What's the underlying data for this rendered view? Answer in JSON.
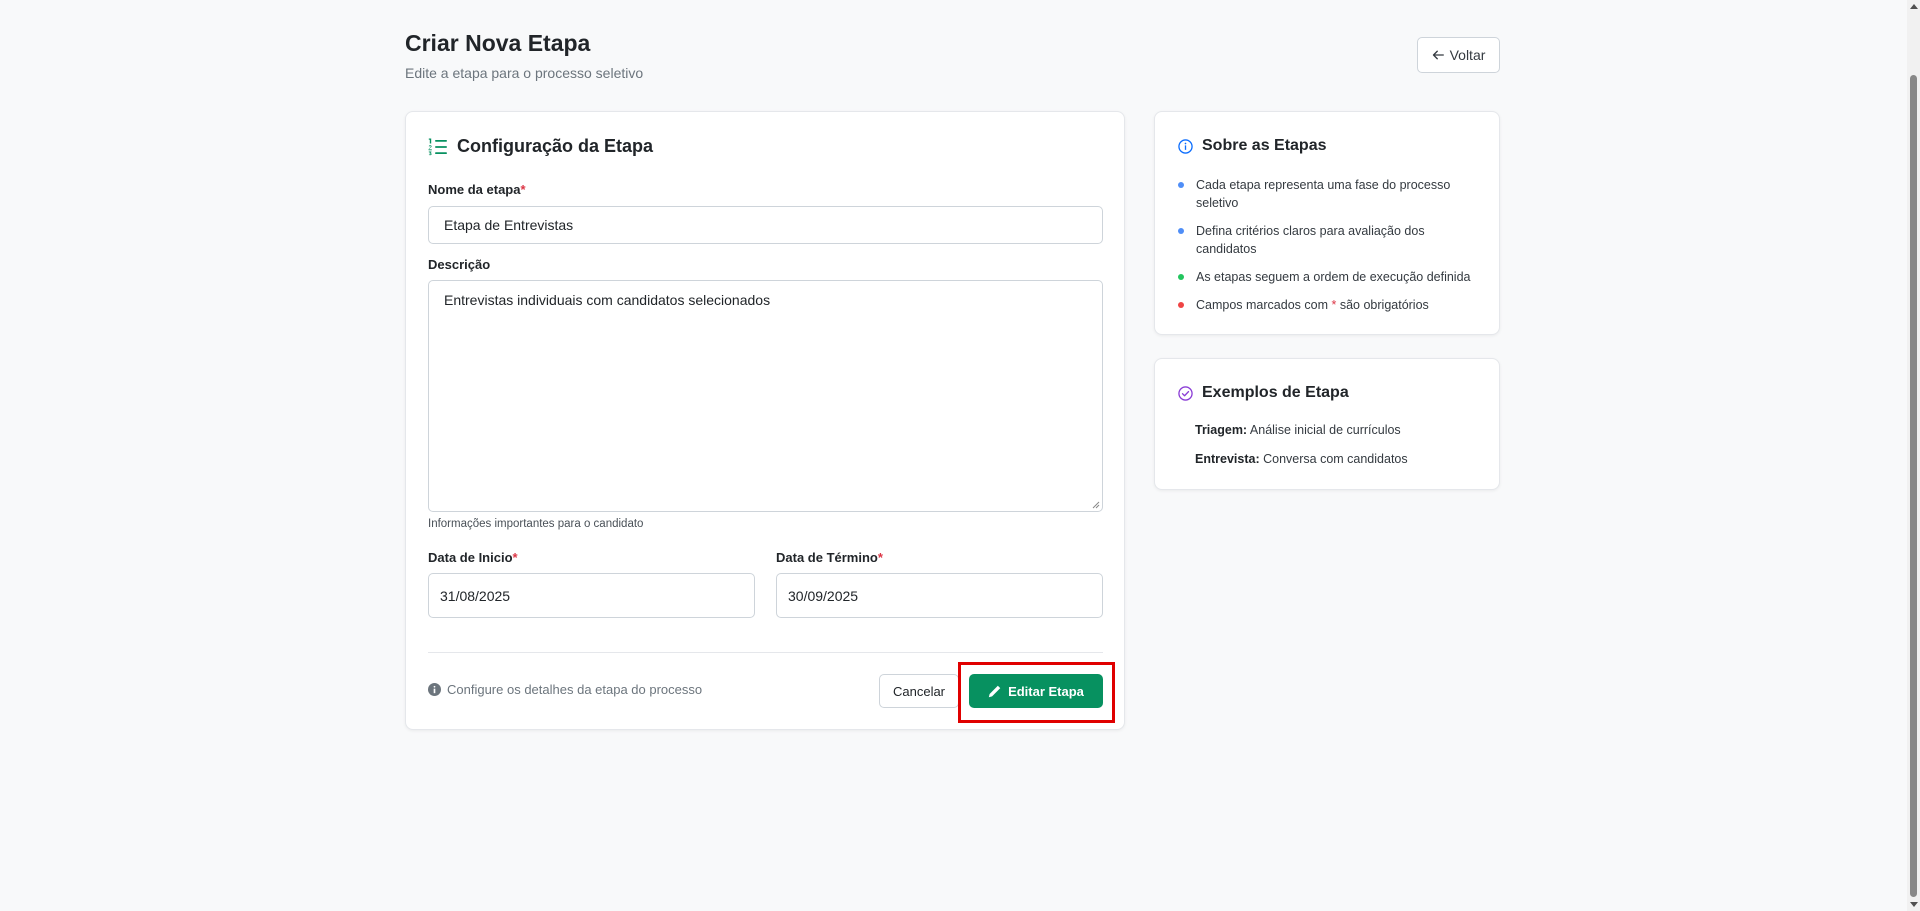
{
  "header": {
    "title": "Criar Nova Etapa",
    "subtitle": "Edite a etapa para o processo seletivo",
    "back_label": "Voltar"
  },
  "form": {
    "title": "Configuração da Etapa",
    "name_label": "Nome da etapa",
    "name_value": "Etapa de Entrevistas",
    "description_label": "Descrição",
    "description_value": "Entrevistas individuais com candidatos selecionados",
    "description_help": "Informações importantes para o candidato",
    "start_label": "Data de Inicio",
    "start_value": "31/08/2025",
    "end_label": "Data de Término",
    "end_value": "30/09/2025",
    "required_mark": "*",
    "footer_note": "Configure os detalhes da etapa do processo",
    "cancel_label": "Cancelar",
    "submit_label": "Editar Etapa"
  },
  "about": {
    "title": "Sobre as Etapas",
    "tips": [
      "Cada etapa representa uma fase do processo seletivo",
      "Defina critérios claros para avaliação dos candidatos",
      "As etapas seguem a ordem de execução definida"
    ],
    "required_tip_prefix": "Campos marcados com",
    "required_tip_mark": "*",
    "required_tip_suffix": "são obrigatórios"
  },
  "examples": {
    "title": "Exemplos de Etapa",
    "items": [
      {
        "term": "Triagem:",
        "text": "Análise inicial de currículos"
      },
      {
        "term": "Entrevista:",
        "text": "Conversa com candidatos"
      }
    ]
  },
  "colors": {
    "primary_green": "#079160",
    "required_red": "#dc3545",
    "info_blue": "#0d6efd",
    "example_purple": "#8b3dd6",
    "dot_blue": "#4f8ef7",
    "dot_green": "#22c55e",
    "dot_red": "#ef4444",
    "highlight": "#e00000"
  },
  "icons": {
    "back": "arrow-left-icon",
    "form": "list-ol-icon",
    "info": "info-circle-icon",
    "examples": "check-circle-icon",
    "footer": "info-fill-icon",
    "submit": "pencil-icon"
  }
}
